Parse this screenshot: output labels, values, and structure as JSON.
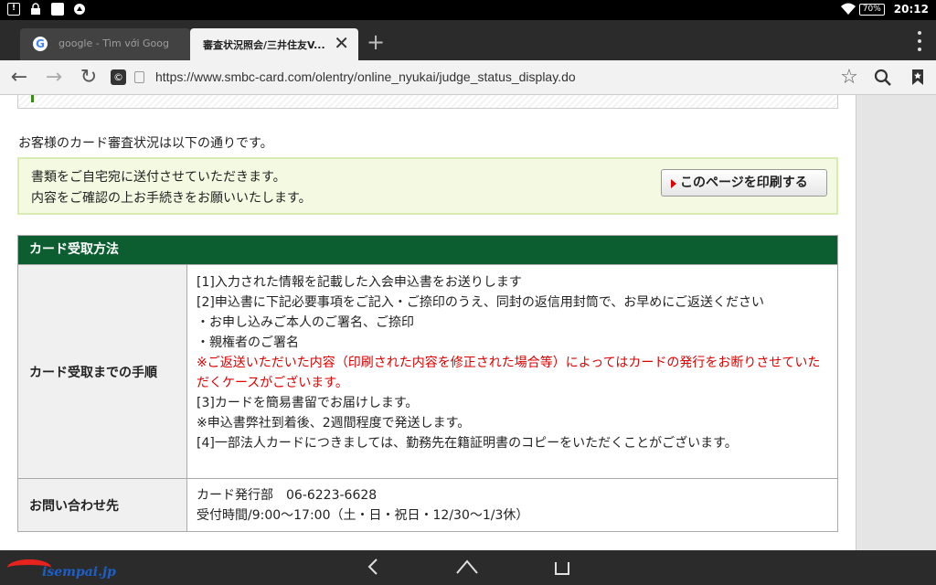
{
  "statusbar": {
    "battery": "70%",
    "time": "20:12"
  },
  "tabs": [
    {
      "title": "google - Tìm với Google",
      "favicon": "G"
    },
    {
      "title": "審査状況照会/三井住友V..."
    }
  ],
  "toolbar": {
    "url": "https://www.smbc-card.com/olentry/online_nyukai/judge_status_display.do",
    "site_icon": "©"
  },
  "page": {
    "intro": "お客様のカード審査状況は以下の通りです。",
    "notice": {
      "line1": "書類をご自宅宛に送付させていただきます。",
      "line2": "内容をご確認の上お手続きをお願いいたします。",
      "print_button": "このページを印刷する"
    },
    "section": {
      "header": "カード受取方法",
      "rows": [
        {
          "label": "カード受取までの手順",
          "lines": [
            "[1]入力された情報を記載した入会申込書をお送りします",
            "[2]申込書に下記必要事項をご記入・ご捺印のうえ、同封の返信用封筒で、お早めにご返送ください",
            "・お申し込みご本人のご署名、ご捺印",
            "・親権者のご署名"
          ],
          "warning": "※ご返送いただいた内容（印刷された内容を修正された場合等）によってはカードの発行をお断りさせていただくケースがございます。",
          "lines2": [
            "[3]カードを簡易書留でお届けします。",
            "※申込書弊社到着後、2週間程度で発送します。",
            "[4]一部法人カードにつきましては、勤務先在籍証明書のコピーをいただくことがございます。"
          ]
        },
        {
          "label": "お問い合わせ先",
          "lines": [
            "カード発行部　06-6223-6628",
            "受付時間/9:00〜17:00（土・日・祝日・12/30〜1/3休）"
          ]
        }
      ]
    }
  },
  "watermark": "isempai.jp",
  "colors": {
    "header_green": "#0c5e31",
    "notice_bg": "#f4f9e1",
    "warning_red": "#e00000"
  },
  "icons": [
    "alert-icon",
    "lock-icon",
    "image-icon",
    "app-icon",
    "wifi-icon",
    "back-icon",
    "forward-icon",
    "reload-icon",
    "star-icon",
    "search-icon",
    "bookmark-icon",
    "home-icon",
    "recents-icon"
  ]
}
